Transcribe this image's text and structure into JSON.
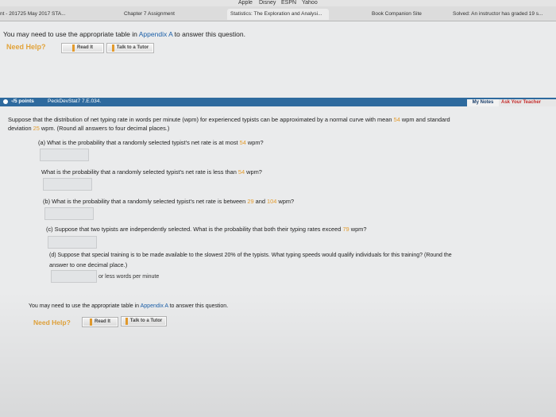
{
  "bookmarks": {
    "apple": "Apple",
    "disney": "Disney",
    "espn": "ESPN",
    "yahoo": "Yahoo"
  },
  "tabs": {
    "t1": "nt - 201725 May 2017 STA...",
    "t2": "Chapter 7 Assignment",
    "t3": "Statistics: The Exploration and Analysi...",
    "t4": "Book Companion Site",
    "t5": "Solved: An instructor has graded 19 s..."
  },
  "intro": {
    "before": "You may need to use the appropriate table in ",
    "link": "Appendix A",
    "after": " to answer this question."
  },
  "help_top": {
    "label": "Need Help?",
    "read": "Read It",
    "talk": "Talk to a Tutor"
  },
  "question": {
    "points": "-/5 points",
    "id": "PeckDevStat7 7.E.034.",
    "my_notes": "My Notes",
    "ask": "Ask Your Teacher",
    "stem1a": "Suppose that the distribution of net typing rate in words per minute (wpm) for experienced typists can be approximated by a normal curve with mean ",
    "mean": "54",
    "stem1b": " wpm and standard",
    "stem2a": "deviation ",
    "sd": "25",
    "stem2b": " wpm. (Round all answers to four decimal places.)",
    "a1a": "(a) What is the probability that a randomly selected typist's net rate is at most ",
    "a1v": "54",
    "a1b": " wpm?",
    "a2a": "What is the probability that a randomly selected typist's net rate is less than ",
    "a2v": "54",
    "a2b": " wpm?",
    "ba": "(b) What is the probability that a randomly selected typist's net rate is between ",
    "bv1": "29",
    "bmid": " and ",
    "bv2": "104",
    "bb": " wpm?",
    "ca": "(c) Suppose that two typists are independently selected. What is the probability that both their typing rates exceed ",
    "cv": "79",
    "cb": " wpm?",
    "d1": "(d) Suppose that special training is to be made available to the slowest 20% of the typists. What typing speeds would qualify individuals for this training? (Round the",
    "d2": "answer to one decimal place.)",
    "d_suffix": "or less words per minute"
  },
  "intro2": {
    "before": "You may need to use the appropriate table in ",
    "link": "Appendix A",
    "after": " to answer this question."
  },
  "help_bottom": {
    "label": "Need Help?",
    "read": "Read It",
    "talk": "Talk to a Tutor"
  }
}
